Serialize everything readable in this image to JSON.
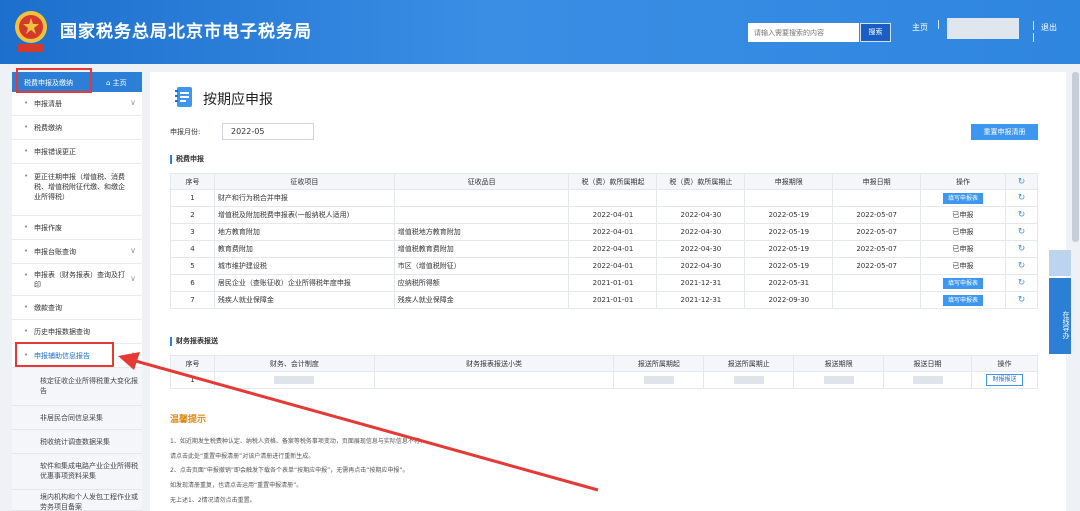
{
  "header": {
    "title": "国家税务总局北京市电子税务局",
    "emblem_text": "中国税务",
    "search_placeholder": "请输入需要搜索的内容",
    "search_button": "搜索",
    "home": "主页",
    "sep": "|",
    "exit": "退出"
  },
  "sidebar": {
    "title": "税费申报及缴纳",
    "home": "主页",
    "items": [
      {
        "label": "申报清册",
        "chevron": "∨"
      },
      {
        "label": "税费缴纳"
      },
      {
        "label": "申报错误更正"
      },
      {
        "label": "更正往期申报（增值税、消费税、增值税附征代缴、和缴企业所得税）"
      },
      {
        "label": "申报作废"
      },
      {
        "label": "申报台账查询",
        "chevron": "∨"
      },
      {
        "label": "申报表（财务报表）查询及打印",
        "chevron": "∨"
      },
      {
        "label": "缴款查询"
      },
      {
        "label": "历史申报数据查询"
      },
      {
        "label": "申报辅助信息报告",
        "chevron": "∧"
      }
    ],
    "subitems": [
      {
        "label": "核定征收企业所得税重大变化报告"
      },
      {
        "label": "非居民合同信息采集"
      },
      {
        "label": "税收统计调查数据采集"
      },
      {
        "label": "软件和集成电路产业企业所得税优惠事项资料采集"
      },
      {
        "label": "境内机构和个人发包工程作业或劳务项目备案"
      }
    ]
  },
  "main": {
    "title": "按期应申报",
    "period_label": "申报月份:",
    "period_value": "2022-05",
    "reset_button": "重置申报清册",
    "tax_section": "税费申报",
    "tax_headers": [
      "序号",
      "征收项目",
      "征收品目",
      "税（费）款所属期起",
      "税（费）款所属期止",
      "申报期限",
      "申报日期",
      "操作",
      "↻"
    ],
    "tax_rows": [
      {
        "no": "1",
        "item": "财产和行为税合并申报",
        "sub": "",
        "start": "",
        "end": "",
        "deadline": "",
        "date": "",
        "op": "填写申报表",
        "op_type": "button"
      },
      {
        "no": "2",
        "item": "增值税及附加税费申报表(一般纳税人适用)",
        "sub": "",
        "start": "2022-04-01",
        "end": "2022-04-30",
        "deadline": "2022-05-19",
        "date": "2022-05-07",
        "op": "已申报",
        "op_type": "text"
      },
      {
        "no": "3",
        "item": "地方教育附加",
        "sub": "增值税地方教育附加",
        "start": "2022-04-01",
        "end": "2022-04-30",
        "deadline": "2022-05-19",
        "date": "2022-05-07",
        "op": "已申报",
        "op_type": "text"
      },
      {
        "no": "4",
        "item": "教育费附加",
        "sub": "增值税教育费附加",
        "start": "2022-04-01",
        "end": "2022-04-30",
        "deadline": "2022-05-19",
        "date": "2022-05-07",
        "op": "已申报",
        "op_type": "text"
      },
      {
        "no": "5",
        "item": "城市维护建设税",
        "sub": "市区（增值税附征）",
        "start": "2022-04-01",
        "end": "2022-04-30",
        "deadline": "2022-05-19",
        "date": "2022-05-07",
        "op": "已申报",
        "op_type": "text"
      },
      {
        "no": "6",
        "item": "居民企业（查账征收）企业所得税年度申报",
        "sub": "应纳税所得额",
        "start": "2021-01-01",
        "end": "2021-12-31",
        "deadline": "2022-05-31",
        "date": "",
        "op": "填写申报表",
        "op_type": "button"
      },
      {
        "no": "7",
        "item": "残疾人就业保障金",
        "sub": "残疾人就业保障金",
        "start": "2021-01-01",
        "end": "2021-12-31",
        "deadline": "2022-09-30",
        "date": "",
        "op": "填写申报表",
        "op_type": "button"
      }
    ],
    "fin_section": "财务报表报送",
    "fin_headers": [
      "序号",
      "财务、会计制度",
      "财务报表报送小类",
      "报送所属期起",
      "报送所属期止",
      "报送期限",
      "报送日期",
      "操作"
    ],
    "fin_rows": [
      {
        "no": "1",
        "op": "财报报送"
      }
    ],
    "tips_title": "温馨提示",
    "tips": [
      "1、如近期发生税费种认定、纳税人资格、备案等税务事项变动，页面展现信息与实际信息不符，",
      "请点击此处“重置申报清册”对该户清册进行重新生成。",
      "2、点击页面“申报撤销”即会触发下载各个表单“按期应申报”，无需再点击“按期应申报”。",
      "如发现清册重复，也请点击运用“重置申报清册”。",
      "无上述1、2情况请勿点击重置。"
    ]
  },
  "float": {
    "online": "在线导办"
  }
}
